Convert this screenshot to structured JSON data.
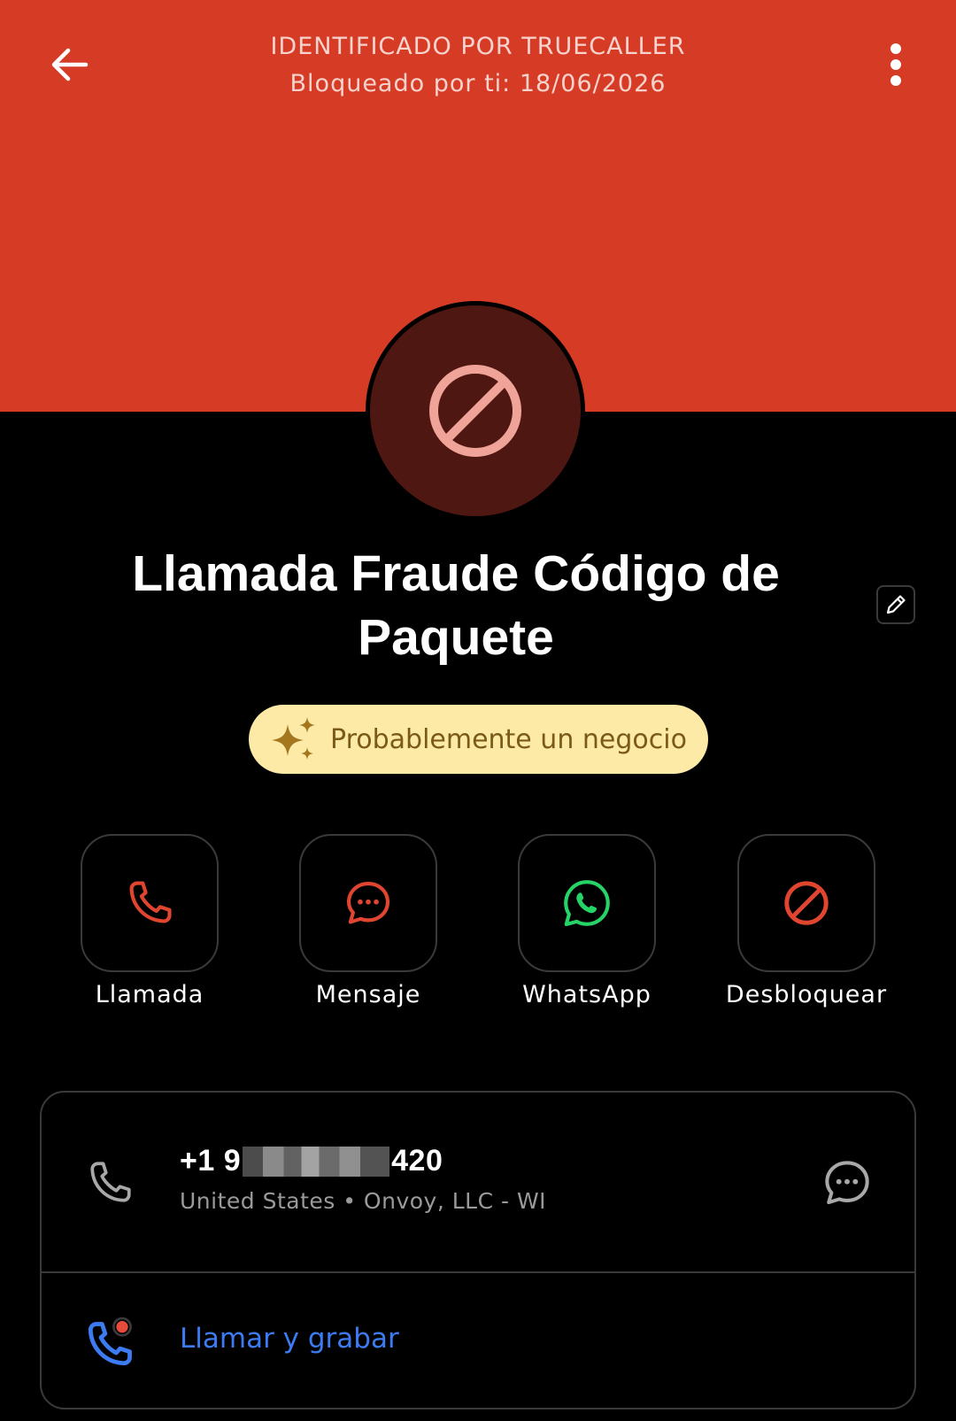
{
  "header": {
    "line1": "IDENTIFICADO POR TRUECALLER",
    "line2": "Bloqueado por ti: 18/06/2026",
    "back_icon": "arrow-left-icon",
    "menu_icon": "more-vertical-icon",
    "background_color": "#D63B26"
  },
  "avatar": {
    "icon": "blocked-icon",
    "background_color": "#4F1712"
  },
  "contact": {
    "name": "Llamada Fraude Código de Paquete",
    "edit_icon": "pencil-icon"
  },
  "badge": {
    "label": "Probablemente un negocio",
    "icon": "sparkle-icon",
    "background_color": "#FCEAA6"
  },
  "actions": [
    {
      "label": "Llamada",
      "icon": "phone-icon",
      "color": "#E0452F"
    },
    {
      "label": "Mensaje",
      "icon": "message-icon",
      "color": "#E0452F"
    },
    {
      "label": "WhatsApp",
      "icon": "whatsapp-icon",
      "color": "#25D366"
    },
    {
      "label": "Desbloquear",
      "icon": "blocked-icon",
      "color": "#E0452F"
    }
  ],
  "number_card": {
    "number_prefix": "+1 9",
    "number_suffix": "420",
    "subline": "United States • Onvoy, LLC - WI",
    "phone_icon": "phone-icon",
    "message_icon": "message-icon"
  },
  "record": {
    "label": "Llamar y grabar",
    "icon": "call-record-icon",
    "color": "#3C7BF2"
  }
}
